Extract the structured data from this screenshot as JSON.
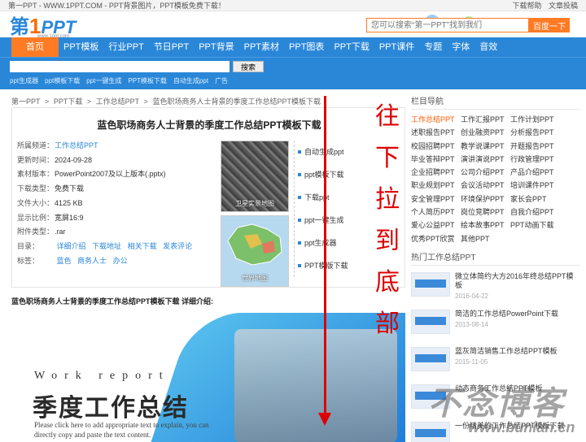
{
  "topbar": {
    "left": "第一PPT - WWW.1PPT.COM - PPT背景图片，PPT模板免费下载！",
    "right_links": [
      "下载帮助",
      "文章投稿"
    ]
  },
  "header": {
    "logo": {
      "a": "第",
      "b": "1",
      "c": "PPT"
    },
    "logo_sub": "www.1ppt.com",
    "search_placeholder": "您可以搜索“第一PPT”找到我们",
    "search_button": "百度一下"
  },
  "nav": {
    "items": [
      "首页",
      "PPT模板",
      "行业PPT",
      "节日PPT",
      "PPT背景",
      "PPT素材",
      "PPT图表",
      "PPT下载",
      "PPT课件",
      "专题",
      "字体",
      "音效"
    ]
  },
  "strip": {
    "search_button": "搜索",
    "tags": [
      "ppt生成器",
      "ppt模板下载",
      "ppt一键生成",
      "PPT模板下载",
      "自动生成ppt"
    ],
    "ad_label": "广告"
  },
  "breadcrumb": [
    "第一PPT",
    ">",
    "PPT下载",
    ">",
    "工作总结PPT",
    ">",
    "蓝色职场商务人士背景的季度工作总结PPT模板下载"
  ],
  "detail": {
    "title": "蓝色职场商务人士背景的季度工作总结PPT模板下载",
    "meta": [
      {
        "k": "所属频道：",
        "v": "工作总结PPT"
      },
      {
        "k": "更新时间：",
        "v": "2024-09-28"
      },
      {
        "k": "素材版本：",
        "v": "PowerPoint2007及以上版本(.pptx)"
      },
      {
        "k": "下载类型：",
        "v": "免费下载"
      },
      {
        "k": "文件大小：",
        "v": "4125 KB"
      },
      {
        "k": "显示比例：",
        "v": "宽屏16:9"
      },
      {
        "k": "附件类型：",
        "v": ".rar"
      }
    ],
    "catalog_label": "目录：",
    "catalog_links": [
      "详细介绍",
      "下载地址",
      "相关下载",
      "发表评论"
    ],
    "tags_label": "标签：",
    "tags": [
      "蓝色",
      "商务人士",
      "办公"
    ],
    "thumbs": [
      "卫星实景地图",
      "世界地图"
    ],
    "download_links": [
      "自动生成ppt",
      "ppt模板下载",
      "下载ppt",
      "ppt一键生成",
      "ppt生成器",
      "PPT模版下载"
    ],
    "intro": "蓝色职场商务人士背景的季度工作总结PPT模板下载 详细介绍:"
  },
  "banner": {
    "work_report": "Work report",
    "big_title": "季度工作总结",
    "small_text_1": "Please click here to add appropriate text to explain, you can",
    "small_text_2": "directly copy and paste the text content."
  },
  "sidebar": {
    "nav_title": "栏目导航",
    "categories": [
      "工作总结PPT",
      "工作汇报PPT",
      "工作计划PPT",
      "述职报告PPT",
      "创业融资PPT",
      "分析报告PPT",
      "校园招聘PPT",
      "教学说课PPT",
      "开题报告PPT",
      "毕业答辩PPT",
      "演讲演说PPT",
      "行政管理PPT",
      "企业招聘PPT",
      "公司介绍PPT",
      "产品介绍PPT",
      "职业规划PPT",
      "会议活动PPT",
      "培训课件PPT",
      "安全管理PPT",
      "环境保护PPT",
      "家长会PPT",
      "个人简历PPT",
      "岗位竞聘PPT",
      "自我介绍PPT",
      "爱心公益PPT",
      "绘本故事PPT",
      "PPT动画下载",
      "优秀PPT欣赏",
      "其他PPT"
    ],
    "hot_title": "热门工作总结PPT",
    "hot_items": [
      {
        "t": "微立体简约大方2016年终总结PPT模板",
        "d": "2016-04-22"
      },
      {
        "t": "简洁的工作总结PowerPoint下载",
        "d": "2013-08-14"
      },
      {
        "t": "蓝灰简洁销售工作总结PPT模板",
        "d": "2015-11-05"
      },
      {
        "t": "动态商务工作总结PPT模板",
        "d": ""
      },
      {
        "t": "一份精美的工作总结PPT模板下载",
        "d": ""
      }
    ]
  },
  "overlay": {
    "vertical_text": [
      "往",
      "下",
      "拉",
      "到",
      "底",
      "部"
    ],
    "watermark": "不念博客",
    "watermark_url": "www.bunian.cn"
  }
}
